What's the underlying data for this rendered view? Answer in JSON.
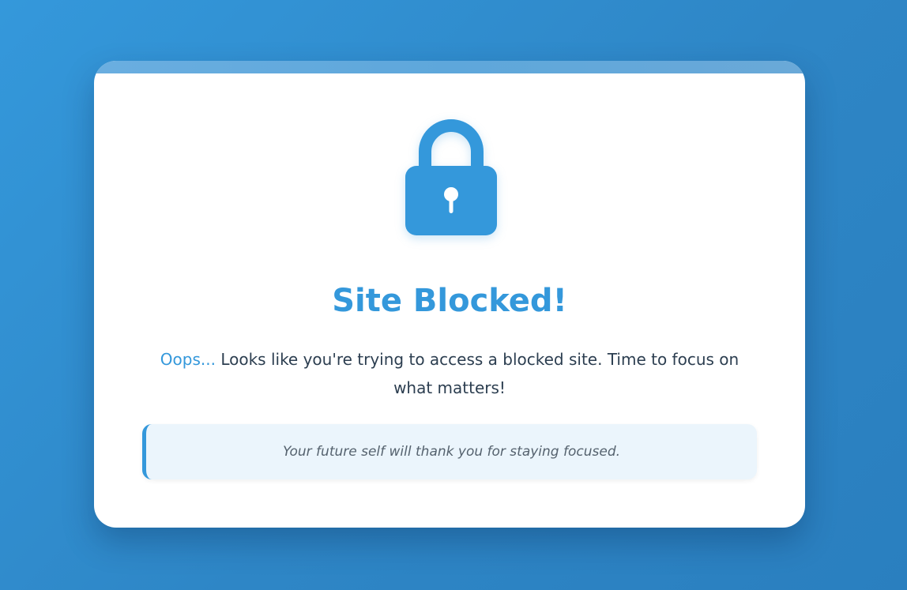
{
  "page": {
    "title": "Site Blocked!",
    "message_prefix": "Oops...",
    "message_body": " Looks like you're trying to access a blocked site. Time to focus on what matters!",
    "quote": "Your future self will thank you for staying focused."
  },
  "icons": {
    "lock": "lock-icon"
  },
  "colors": {
    "accent": "#3498db",
    "background_start": "#3498db",
    "background_end": "#2a7fbf",
    "text_dark": "#2c3e50",
    "quote_background": "#ebf5fc",
    "quote_text": "#55626e"
  }
}
